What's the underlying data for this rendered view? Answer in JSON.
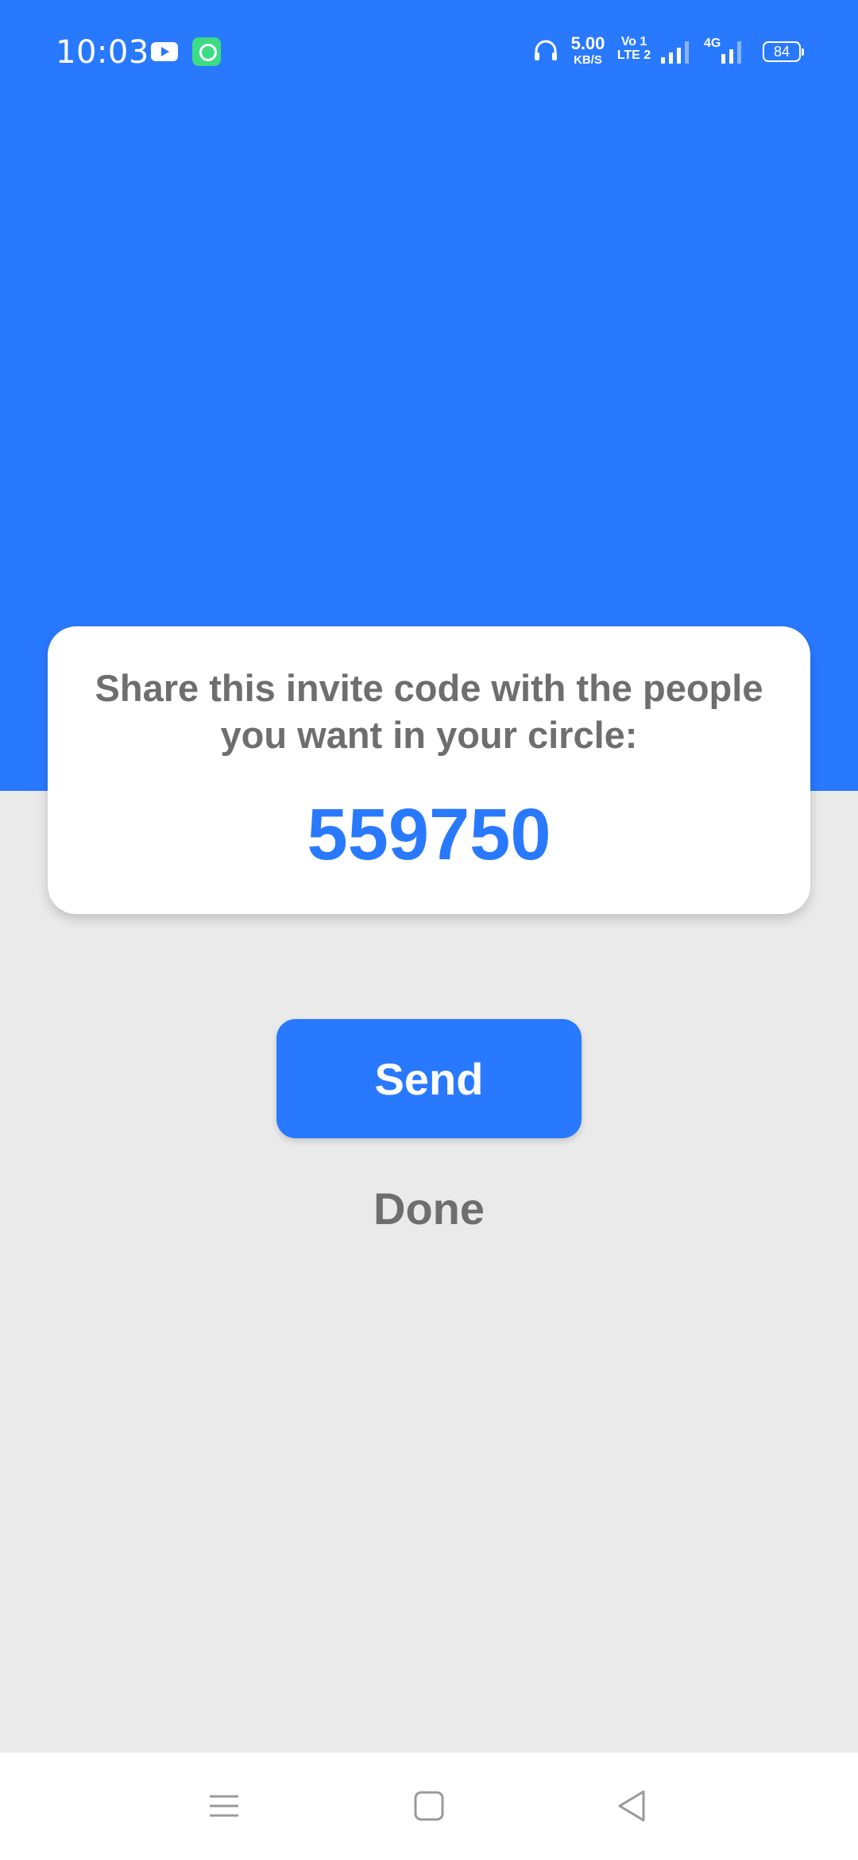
{
  "status_bar": {
    "time": "10:03",
    "net_speed": "5.00",
    "net_speed_unit": "KB/S",
    "volte_top": "Vo 1",
    "volte_bottom": "LTE 2",
    "network_type": "4G",
    "battery": "84"
  },
  "colors": {
    "primary": "#2979FF",
    "background": "#EAEAEA",
    "text_gray": "#6E6E6E"
  },
  "card": {
    "message": "Share this invite code with the people you want in your circle:",
    "invite_code": "559750"
  },
  "actions": {
    "send_label": "Send",
    "done_label": "Done"
  },
  "nav": {
    "icons": [
      "menu-icon",
      "home-icon",
      "back-icon"
    ]
  }
}
